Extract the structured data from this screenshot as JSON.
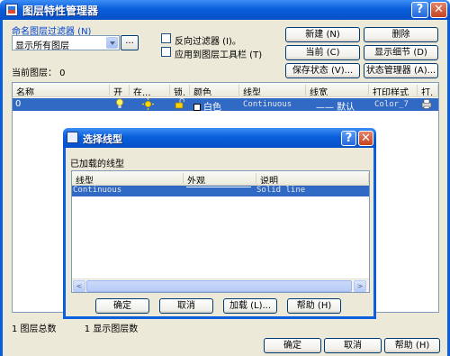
{
  "window": {
    "title": "图层特性管理器",
    "help_label": "?",
    "close_label": "✕"
  },
  "filter": {
    "group_label": "命名图层过滤器 (N)",
    "selected": "显示所有图层",
    "dots_label": "...",
    "invert_label": "反向过滤器 (I)。",
    "apply_toolbar_label": "应用到图层工具栏 (T)"
  },
  "buttons": {
    "new": "新建 (N)",
    "delete": "删除",
    "current": "当前 (C)",
    "details": "显示细节 (D)",
    "save_state": "保存状态 (V)...",
    "state_manager": "状态管理器 (A)..."
  },
  "current_layer": "当前图层： 0",
  "layer_table": {
    "columns": [
      "名称",
      "开",
      "在...",
      "锁.",
      "颜色",
      "线型",
      "线宽",
      "打印样式",
      "打."
    ],
    "rows": [
      {
        "name": "0",
        "color": "白色",
        "linetype": "Continuous",
        "lineweight": "—— 默认",
        "plotstyle": "Color_7"
      }
    ]
  },
  "status": {
    "total": "1  图层总数",
    "shown": "1  显示图层数"
  },
  "bottom_buttons": {
    "ok": "确定",
    "cancel": "取消",
    "help": "帮助 (H)"
  },
  "linetype_dialog": {
    "title": "选择线型",
    "help_label": "?",
    "close_label": "✕",
    "loaded_label": "已加载的线型",
    "columns": [
      "线型",
      "外观",
      "说明"
    ],
    "rows": [
      {
        "linetype": "Continuous",
        "description": "Solid line"
      }
    ],
    "scroll_left": "<",
    "scroll_right": ">",
    "ok": "确定",
    "cancel": "取消",
    "load": "加载 (L)...",
    "help": "帮助 (H)"
  },
  "colors": {
    "title_blue": "#0a5fdc",
    "selection": "#316ac5",
    "dialog_bg": "#ece9d8",
    "close_red": "#c6431f"
  }
}
